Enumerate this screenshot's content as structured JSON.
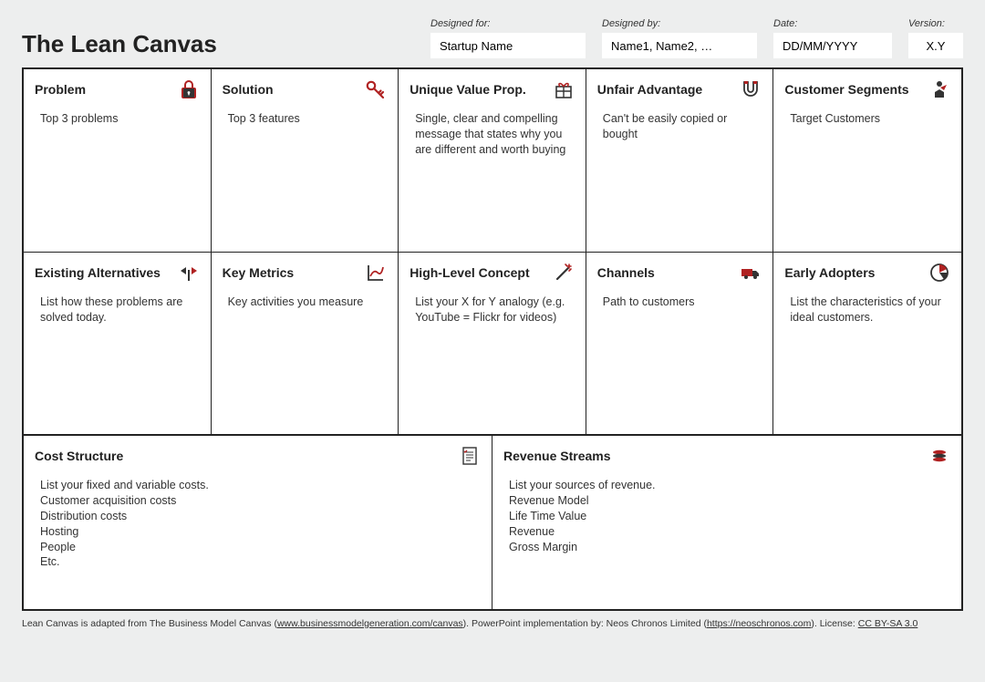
{
  "title": "The Lean Canvas",
  "meta": {
    "designed_for_label": "Designed for:",
    "designed_for_value": "Startup Name",
    "designed_by_label": "Designed by:",
    "designed_by_value": "Name1, Name2, …",
    "date_label": "Date:",
    "date_value": "DD/MM/YYYY",
    "version_label": "Version:",
    "version_value": "X.Y"
  },
  "cells": {
    "problem": {
      "title": "Problem",
      "body": "Top 3 problems"
    },
    "solution": {
      "title": "Solution",
      "body": "Top 3 features"
    },
    "uvp": {
      "title": "Unique Value Prop.",
      "body": "Single, clear and compelling message that states why you are different and worth buying"
    },
    "unfair": {
      "title": "Unfair Advantage",
      "body": "Can't be easily copied or bought"
    },
    "segments": {
      "title": "Customer Segments",
      "body": "Target Customers"
    },
    "alternatives": {
      "title": "Existing Alternatives",
      "body": "List how these problems are solved today."
    },
    "metrics": {
      "title": "Key Metrics",
      "body": "Key activities you measure"
    },
    "concept": {
      "title": "High-Level Concept",
      "body": "List your X for Y analogy (e.g. YouTube = Flickr for videos)"
    },
    "channels": {
      "title": "Channels",
      "body": "Path to customers"
    },
    "adopters": {
      "title": "Early Adopters",
      "body": "List the characteristics of your ideal customers."
    },
    "cost": {
      "title": "Cost Structure",
      "lines": [
        "List your fixed and variable costs.",
        "Customer acquisition costs",
        "Distribution costs",
        "Hosting",
        "People",
        "Etc."
      ]
    },
    "revenue": {
      "title": "Revenue Streams",
      "lines": [
        "List your sources of revenue.",
        "Revenue Model",
        "Life Time Value",
        "Revenue",
        "Gross Margin"
      ]
    }
  },
  "footer": {
    "pre": "Lean Canvas is adapted from The Business Model Canvas (",
    "link1": "www.businessmodelgeneration.com/canvas",
    "mid": "). PowerPoint implementation by: Neos Chronos Limited (",
    "link2": "https://neoschronos.com",
    "post": "). License: ",
    "license": "CC BY-SA 3.0"
  }
}
